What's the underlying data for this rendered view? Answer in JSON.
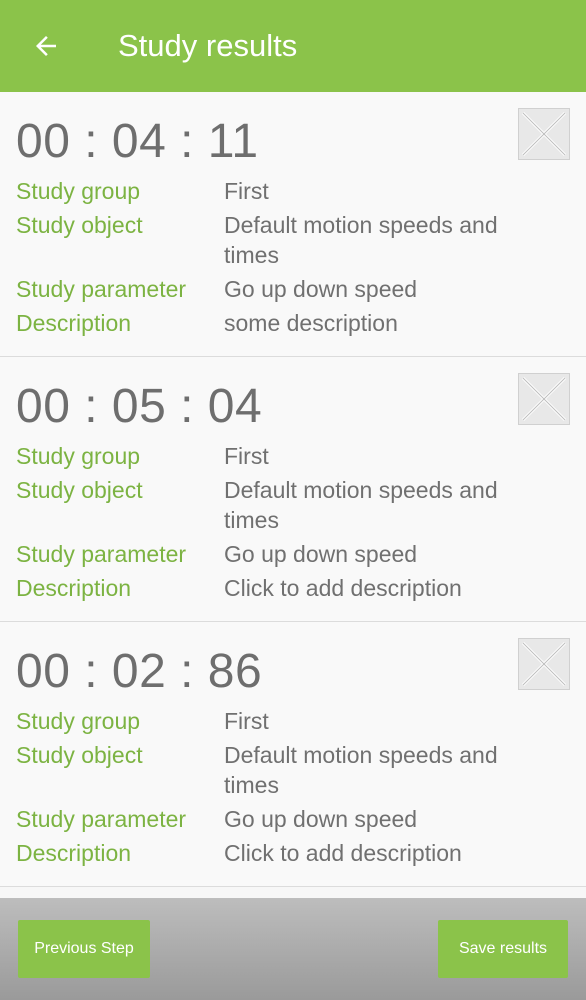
{
  "header": {
    "title": "Study results",
    "back_icon": "arrow-back-icon"
  },
  "results": [
    {
      "time": "00 : 04 : 11",
      "fields": [
        {
          "label": "Study group",
          "value": "First"
        },
        {
          "label": "Study object",
          "value": "Default motion speeds and times"
        },
        {
          "label": "Study parameter",
          "value": "Go up down speed"
        },
        {
          "label": "Description",
          "value": "some description"
        }
      ]
    },
    {
      "time": "00 : 05 : 04",
      "fields": [
        {
          "label": "Study group",
          "value": "First"
        },
        {
          "label": "Study object",
          "value": "Default motion speeds and times"
        },
        {
          "label": "Study parameter",
          "value": "Go up down speed"
        },
        {
          "label": "Description",
          "value": "Click to add description"
        }
      ]
    },
    {
      "time": "00 : 02 : 86",
      "fields": [
        {
          "label": "Study group",
          "value": "First"
        },
        {
          "label": "Study object",
          "value": "Default motion speeds and times"
        },
        {
          "label": "Study parameter",
          "value": "Go up down speed"
        },
        {
          "label": "Description",
          "value": "Click to add description"
        }
      ]
    }
  ],
  "footer": {
    "previous_label": "Previous Step",
    "save_label": "Save results"
  },
  "colors": {
    "accent": "#8bc34a",
    "label_green": "#7cb342",
    "value_gray": "#707070"
  }
}
